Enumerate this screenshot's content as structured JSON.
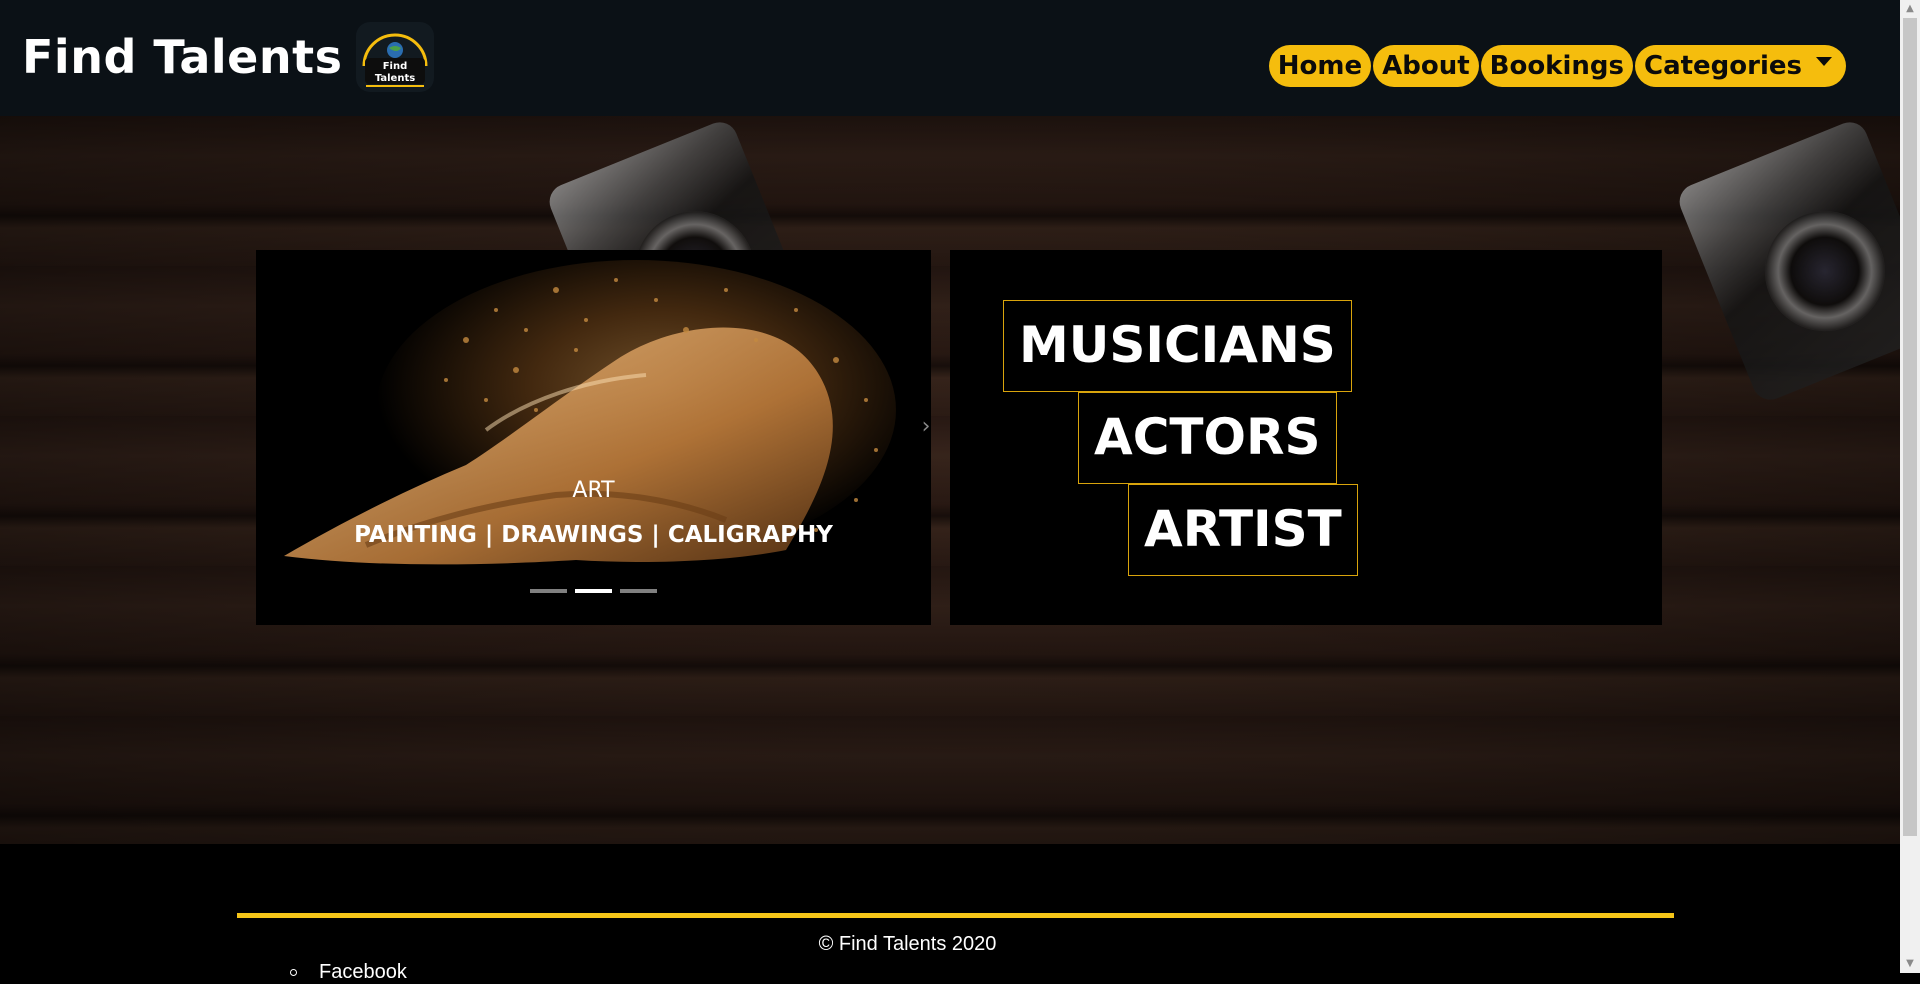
{
  "header": {
    "brand_title": "Find Talents",
    "logo_text_line1": "Find",
    "logo_text_line2": "Talents",
    "nav": [
      {
        "label": "Home"
      },
      {
        "label": "About"
      },
      {
        "label": "Bookings"
      },
      {
        "label": "Categories",
        "has_dropdown": true
      }
    ]
  },
  "carousel": {
    "caption_title": "ART",
    "caption_subtitle": "PAINTING | DRAWINGS | CALIGRAPHY",
    "slide_count": 3,
    "active_slide_index": 1
  },
  "categories": {
    "items": [
      {
        "label": "MUSICIANS"
      },
      {
        "label": "ACTORS"
      },
      {
        "label": "ARTIST"
      }
    ]
  },
  "footer": {
    "copyright": "© Find Talents 2020",
    "social_first_item": "Facebook"
  },
  "colors": {
    "accent": "#f5bd0d",
    "header_bg": "#0b1116",
    "category_border": "#d9a40c",
    "footer_line": "#f5c518"
  }
}
